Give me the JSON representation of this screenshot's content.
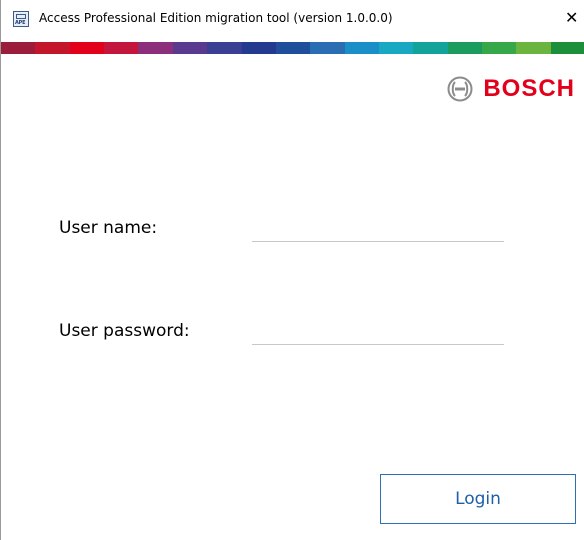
{
  "window": {
    "title": "Access Professional Edition migration tool (version 1.0.0.0)",
    "app_icon_label": "APE",
    "close_glyph": "✕"
  },
  "supergraphic_colors": [
    "#9b1d3b",
    "#c4162a",
    "#e2001a",
    "#c4163c",
    "#8b2f7a",
    "#5a3a8e",
    "#3b3f93",
    "#243a8f",
    "#1f4e9b",
    "#2a6db3",
    "#1a8ec7",
    "#18a8c2",
    "#14a39a",
    "#1b9b5e",
    "#36a84a",
    "#6bb43d",
    "#1d8f3c"
  ],
  "brand": {
    "logo_text": "BOSCH",
    "logo_color": "#e2001a",
    "logo_icon": "bosch-armature-icon"
  },
  "form": {
    "user_name_label": "User name:",
    "user_name_value": "",
    "user_password_label": "User password:",
    "user_password_value": "",
    "login_label": "Login"
  },
  "colors": {
    "accent": "#2f6fb3",
    "field_underline": "#c8c8c8"
  }
}
